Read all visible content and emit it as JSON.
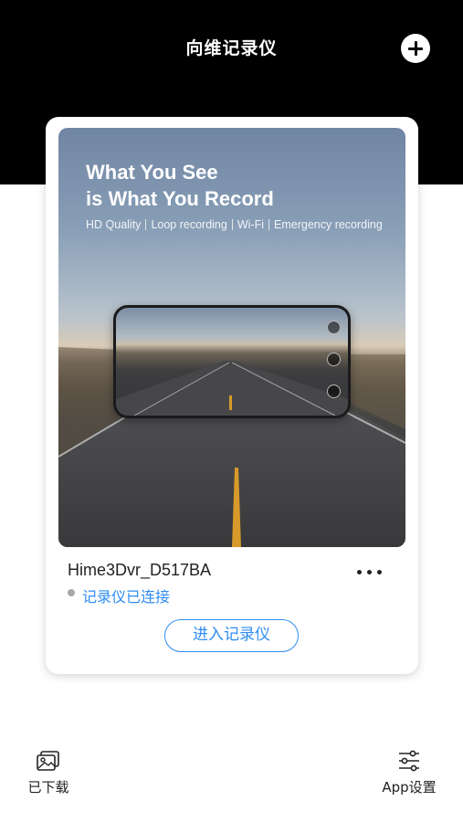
{
  "header": {
    "title": "向维记录仪",
    "add_icon": "plus-circle-icon",
    "background": "#000000"
  },
  "device_card": {
    "banner": {
      "headline_line1": "What You See",
      "headline_line2": "is What You Record",
      "features": [
        "HD Quality",
        "Loop recording",
        "Wi-Fi",
        "Emergency recording"
      ]
    },
    "device_name": "Hime3Dvr_D517BA",
    "more_icon": "more-horizontal-icon",
    "status_text": "记录仪已连接",
    "status_color": "#2f8cf0",
    "enter_button_label": "进入记录仪"
  },
  "bottom_nav": {
    "downloaded": {
      "label": "已下载",
      "icon": "gallery-icon"
    },
    "settings": {
      "label": "App设置",
      "icon": "sliders-icon"
    }
  },
  "colors": {
    "accent": "#2f8cf0",
    "text": "#222222"
  }
}
